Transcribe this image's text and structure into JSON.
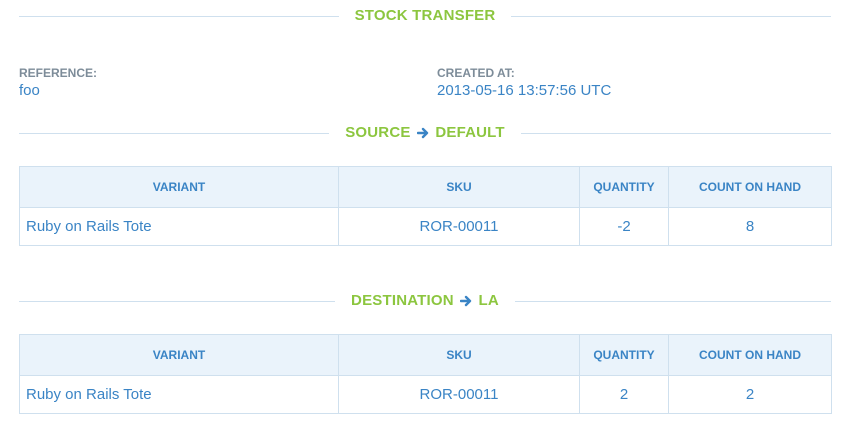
{
  "header": {
    "title": "STOCK TRANSFER"
  },
  "meta": {
    "reference_label": "REFERENCE:",
    "reference_value": "foo",
    "created_label": "CREATED AT:",
    "created_value": "2013-05-16 13:57:56 UTC"
  },
  "source": {
    "prefix": "SOURCE",
    "location": "DEFAULT",
    "columns": [
      "VARIANT",
      "SKU",
      "QUANTITY",
      "COUNT ON HAND"
    ],
    "rows": [
      {
        "variant": "Ruby on Rails Tote",
        "sku": "ROR-00011",
        "quantity": "-2",
        "count_on_hand": "8"
      }
    ]
  },
  "destination": {
    "prefix": "DESTINATION",
    "location": "LA",
    "columns": [
      "VARIANT",
      "SKU",
      "QUANTITY",
      "COUNT ON HAND"
    ],
    "rows": [
      {
        "variant": "Ruby on Rails Tote",
        "sku": "ROR-00011",
        "quantity": "2",
        "count_on_hand": "2"
      }
    ]
  },
  "colors": {
    "title_green": "#8cc63f",
    "link_blue": "#3a84c5",
    "label_gray": "#7d8c99",
    "header_bg": "#eaf3fb",
    "border": "#cfe0ee"
  },
  "icons": {
    "section_arrow": "arrow-right-icon"
  }
}
